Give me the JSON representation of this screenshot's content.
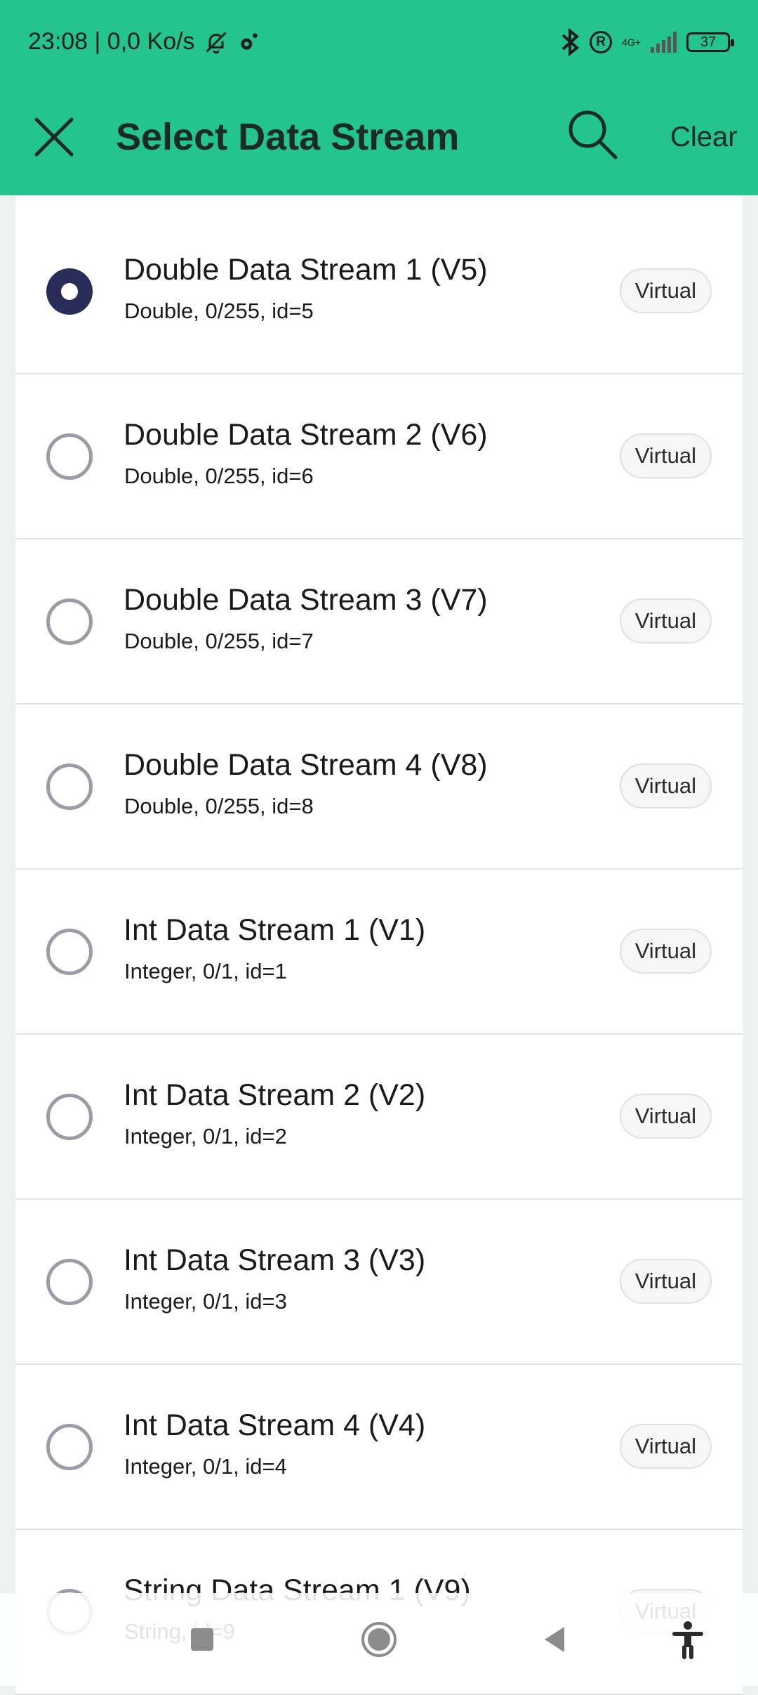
{
  "status_bar": {
    "time_speed": "23:08 | 0,0 Ko/s",
    "network_type": "4G+",
    "battery": "37"
  },
  "app_bar": {
    "title": "Select Data Stream",
    "clear_label": "Clear"
  },
  "streams": [
    {
      "name": "Double Data Stream 1 (V5)",
      "subtitle": "Double, 0/255, id=5",
      "badge": "Virtual",
      "selected": true
    },
    {
      "name": "Double Data Stream 2 (V6)",
      "subtitle": "Double, 0/255, id=6",
      "badge": "Virtual",
      "selected": false
    },
    {
      "name": "Double Data Stream 3 (V7)",
      "subtitle": "Double, 0/255, id=7",
      "badge": "Virtual",
      "selected": false
    },
    {
      "name": "Double Data Stream 4 (V8)",
      "subtitle": "Double, 0/255, id=8",
      "badge": "Virtual",
      "selected": false
    },
    {
      "name": "Int Data Stream 1 (V1)",
      "subtitle": "Integer, 0/1, id=1",
      "badge": "Virtual",
      "selected": false
    },
    {
      "name": "Int Data Stream 2 (V2)",
      "subtitle": "Integer, 0/1, id=2",
      "badge": "Virtual",
      "selected": false
    },
    {
      "name": "Int Data Stream 3 (V3)",
      "subtitle": "Integer, 0/1, id=3",
      "badge": "Virtual",
      "selected": false
    },
    {
      "name": "Int Data Stream 4 (V4)",
      "subtitle": "Integer, 0/1, id=4",
      "badge": "Virtual",
      "selected": false
    },
    {
      "name": "String Data Stream 1 (V9)",
      "subtitle": "String, id=9",
      "badge": "Virtual",
      "selected": false
    }
  ],
  "colors": {
    "app_bar": "#23c48e",
    "radio_selected": "#282c57",
    "radio_unselected": "#9d9ba8"
  },
  "icons": {
    "close": "close-icon",
    "search": "search-icon",
    "nav_recents": "square-icon",
    "nav_home": "circle-icon",
    "nav_back": "triangle-back-icon",
    "accessibility": "accessibility-icon"
  }
}
